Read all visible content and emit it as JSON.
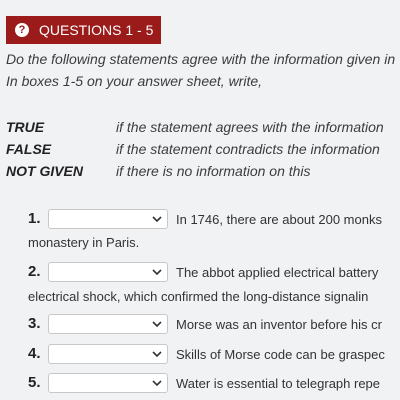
{
  "header": {
    "badge_label": "QUESTIONS 1 - 5",
    "badge_icon": "question-circle-icon"
  },
  "instructions": {
    "line1": "Do the following statements agree with the information given in",
    "line2": "In boxes 1-5 on your answer sheet, write,"
  },
  "key": [
    {
      "label": "TRUE",
      "desc": "if the statement agrees with the information"
    },
    {
      "label": "FALSE",
      "desc": "if the statement contradicts the information"
    },
    {
      "label": "NOT GIVEN",
      "desc": "if there is no information on this"
    }
  ],
  "questions": [
    {
      "number": "1.",
      "selected": "",
      "text": "In 1746, there are about 200 monks",
      "continuation": "monastery in Paris."
    },
    {
      "number": "2.",
      "selected": "",
      "text": "The abbot applied electrical battery",
      "continuation": "electrical shock, which confirmed the long-distance signalin"
    },
    {
      "number": "3.",
      "selected": "",
      "text": "Morse was an inventor before his cr",
      "continuation": ""
    },
    {
      "number": "4.",
      "selected": "",
      "text": "Skills of Morse code can be graspec",
      "continuation": ""
    },
    {
      "number": "5.",
      "selected": "",
      "text": "Water is essential to telegraph repe",
      "continuation": ""
    }
  ]
}
